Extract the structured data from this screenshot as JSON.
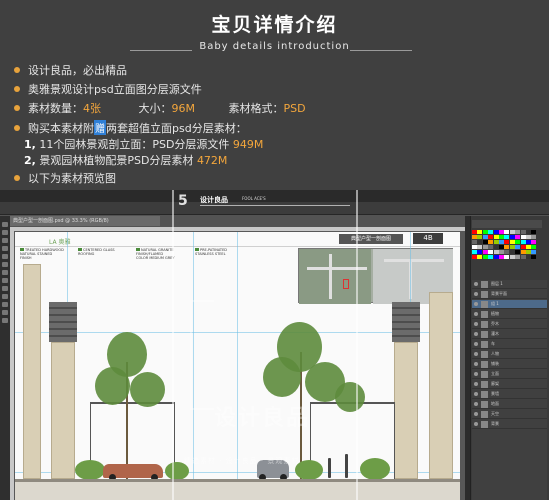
{
  "header": {
    "title": "宝贝详情介绍",
    "subtitle": "Baby details introduction"
  },
  "bullets": {
    "line1": "设计良品，必出精品",
    "line2": "奥雅景观设计psd立面图分层源文件",
    "line3": {
      "qty_label": "素材数量：",
      "qty_value": "4张",
      "size_label": "大小：",
      "size_value": "96M",
      "format_label": "素材格式：",
      "format_value": "PSD"
    },
    "line4": {
      "pre": "购买本素材附",
      "gift": "赠",
      "post": "两套超值立面psd分层素材："
    },
    "sub1": {
      "num": "1,",
      "text": " 11个园林景观剖立面：PSD分层源文件 ",
      "value": "949M"
    },
    "sub2": {
      "num": "2,",
      "text": " 景观园林植物配景PSD分层素材 ",
      "value": "472M"
    },
    "line5": "以下为素材预览图"
  },
  "photoshop": {
    "doc_tab": "典型户型一剖面图.psd @ 33.3% (RGB/8)",
    "drawing": {
      "brand": "LA 奥雅",
      "title": "典型户型一剖面图",
      "number": "4B",
      "legend_a": [
        "TREATED HARDWOOD",
        "NATURAL STAINED",
        "FINISH"
      ],
      "legend_b": [
        "CENTERED GLASS",
        "ROOFING"
      ],
      "legend_c": [
        "NATURAL GRANITE",
        "FINISH/FLAMED",
        "COLOR MEDIUM GREY"
      ],
      "legend_d": [
        "PRE-PATINATED",
        "STAINLESS STEEL"
      ]
    },
    "watermark": {
      "logo": "5",
      "text1": "设计良品",
      "text2": "FOOL ACE'S",
      "mid": "设计良品",
      "bottom": "精选素材 · 设计良品 · 景观素材"
    },
    "layers": [
      "图层 1",
      "背景平面",
      "组 1",
      "植物",
      "乔木",
      "灌木",
      "车",
      "人物",
      "铺装",
      "立面",
      "廊架",
      "景墙",
      "地面",
      "天空",
      "背景"
    ],
    "swatch_colors": [
      "#ff0000",
      "#ffff00",
      "#00ff00",
      "#00ffff",
      "#0000ff",
      "#ff00ff",
      "#ffffff",
      "#cccccc",
      "#999999",
      "#666666",
      "#333333",
      "#000000",
      "#ff9900",
      "#99cc00",
      "#3399ff"
    ]
  }
}
